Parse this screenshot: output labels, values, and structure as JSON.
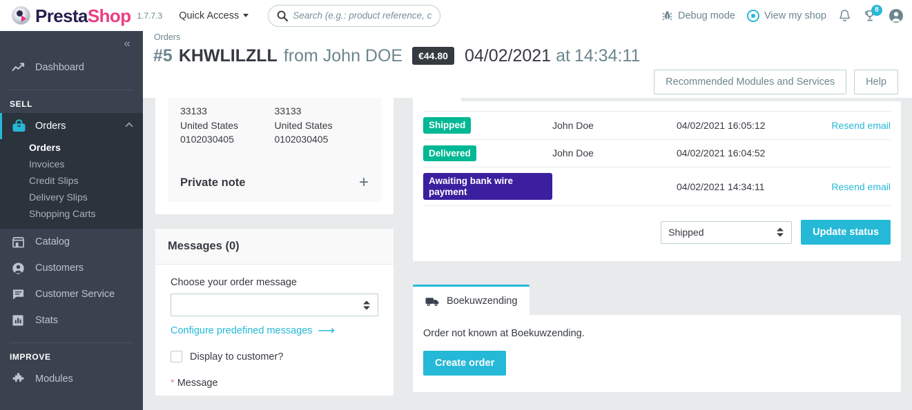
{
  "header": {
    "brand_presta": "Presta",
    "brand_shop": "Shop",
    "version": "1.7.7.3",
    "quick_access": "Quick Access",
    "search_placeholder": "Search (e.g.: product reference, customer name...)",
    "debug_mode": "Debug mode",
    "view_my_shop": "View my shop",
    "notification_badge": "8"
  },
  "sidebar": {
    "dashboard": "Dashboard",
    "section_sell": "SELL",
    "section_improve": "IMPROVE",
    "orders": "Orders",
    "submenu": [
      {
        "label": "Orders",
        "current": true
      },
      {
        "label": "Invoices",
        "current": false
      },
      {
        "label": "Credit Slips",
        "current": false
      },
      {
        "label": "Delivery Slips",
        "current": false
      },
      {
        "label": "Shopping Carts",
        "current": false
      }
    ],
    "catalog": "Catalog",
    "customers": "Customers",
    "customer_service": "Customer Service",
    "stats": "Stats",
    "modules": "Modules"
  },
  "page": {
    "breadcrumb": "Orders",
    "order_number": "#5",
    "order_reference": "KHWLILZLL",
    "from_customer": "from John DOE",
    "price": "€44.80",
    "date": "04/02/2021",
    "at": "at",
    "time": "14:34:11",
    "recommended_modules": "Recommended Modules and Services",
    "help": "Help"
  },
  "address": {
    "left": {
      "zip": "33133",
      "country": "United States",
      "phone": "0102030405"
    },
    "right": {
      "zip": "33133",
      "country": "United States",
      "phone": "0102030405"
    }
  },
  "private_note": {
    "title": "Private note",
    "toggle": "+"
  },
  "messages": {
    "title": "Messages (0)",
    "choose_label": "Choose your order message",
    "select_value": "",
    "configure_link": "Configure predefined messages",
    "display_to_customer": "Display to customer?",
    "message_label": "Message",
    "required_mark": "*"
  },
  "status_history": {
    "rows": [
      {
        "status": "Shipped",
        "color": "#00b894",
        "user": "John Doe",
        "date": "04/02/2021 16:05:12",
        "action": "Resend email"
      },
      {
        "status": "Delivered",
        "color": "#00b894",
        "user": "John Doe",
        "date": "04/02/2021 16:04:52",
        "action": ""
      },
      {
        "status": "Awaiting bank wire payment",
        "color": "#3b1f9e",
        "user": "",
        "date": "04/02/2021 14:34:11",
        "action": "Resend email"
      }
    ],
    "selected_status": "Shipped",
    "update_button": "Update status"
  },
  "carrier": {
    "tab_label": "Boekuwzending",
    "message": "Order not known at Boekuwzending.",
    "create_button": "Create order"
  },
  "colors": {
    "accent": "#25b9d7",
    "sidebar": "#39424e",
    "page_bg": "#e8eaec",
    "brand_pink": "#ec3f80"
  }
}
